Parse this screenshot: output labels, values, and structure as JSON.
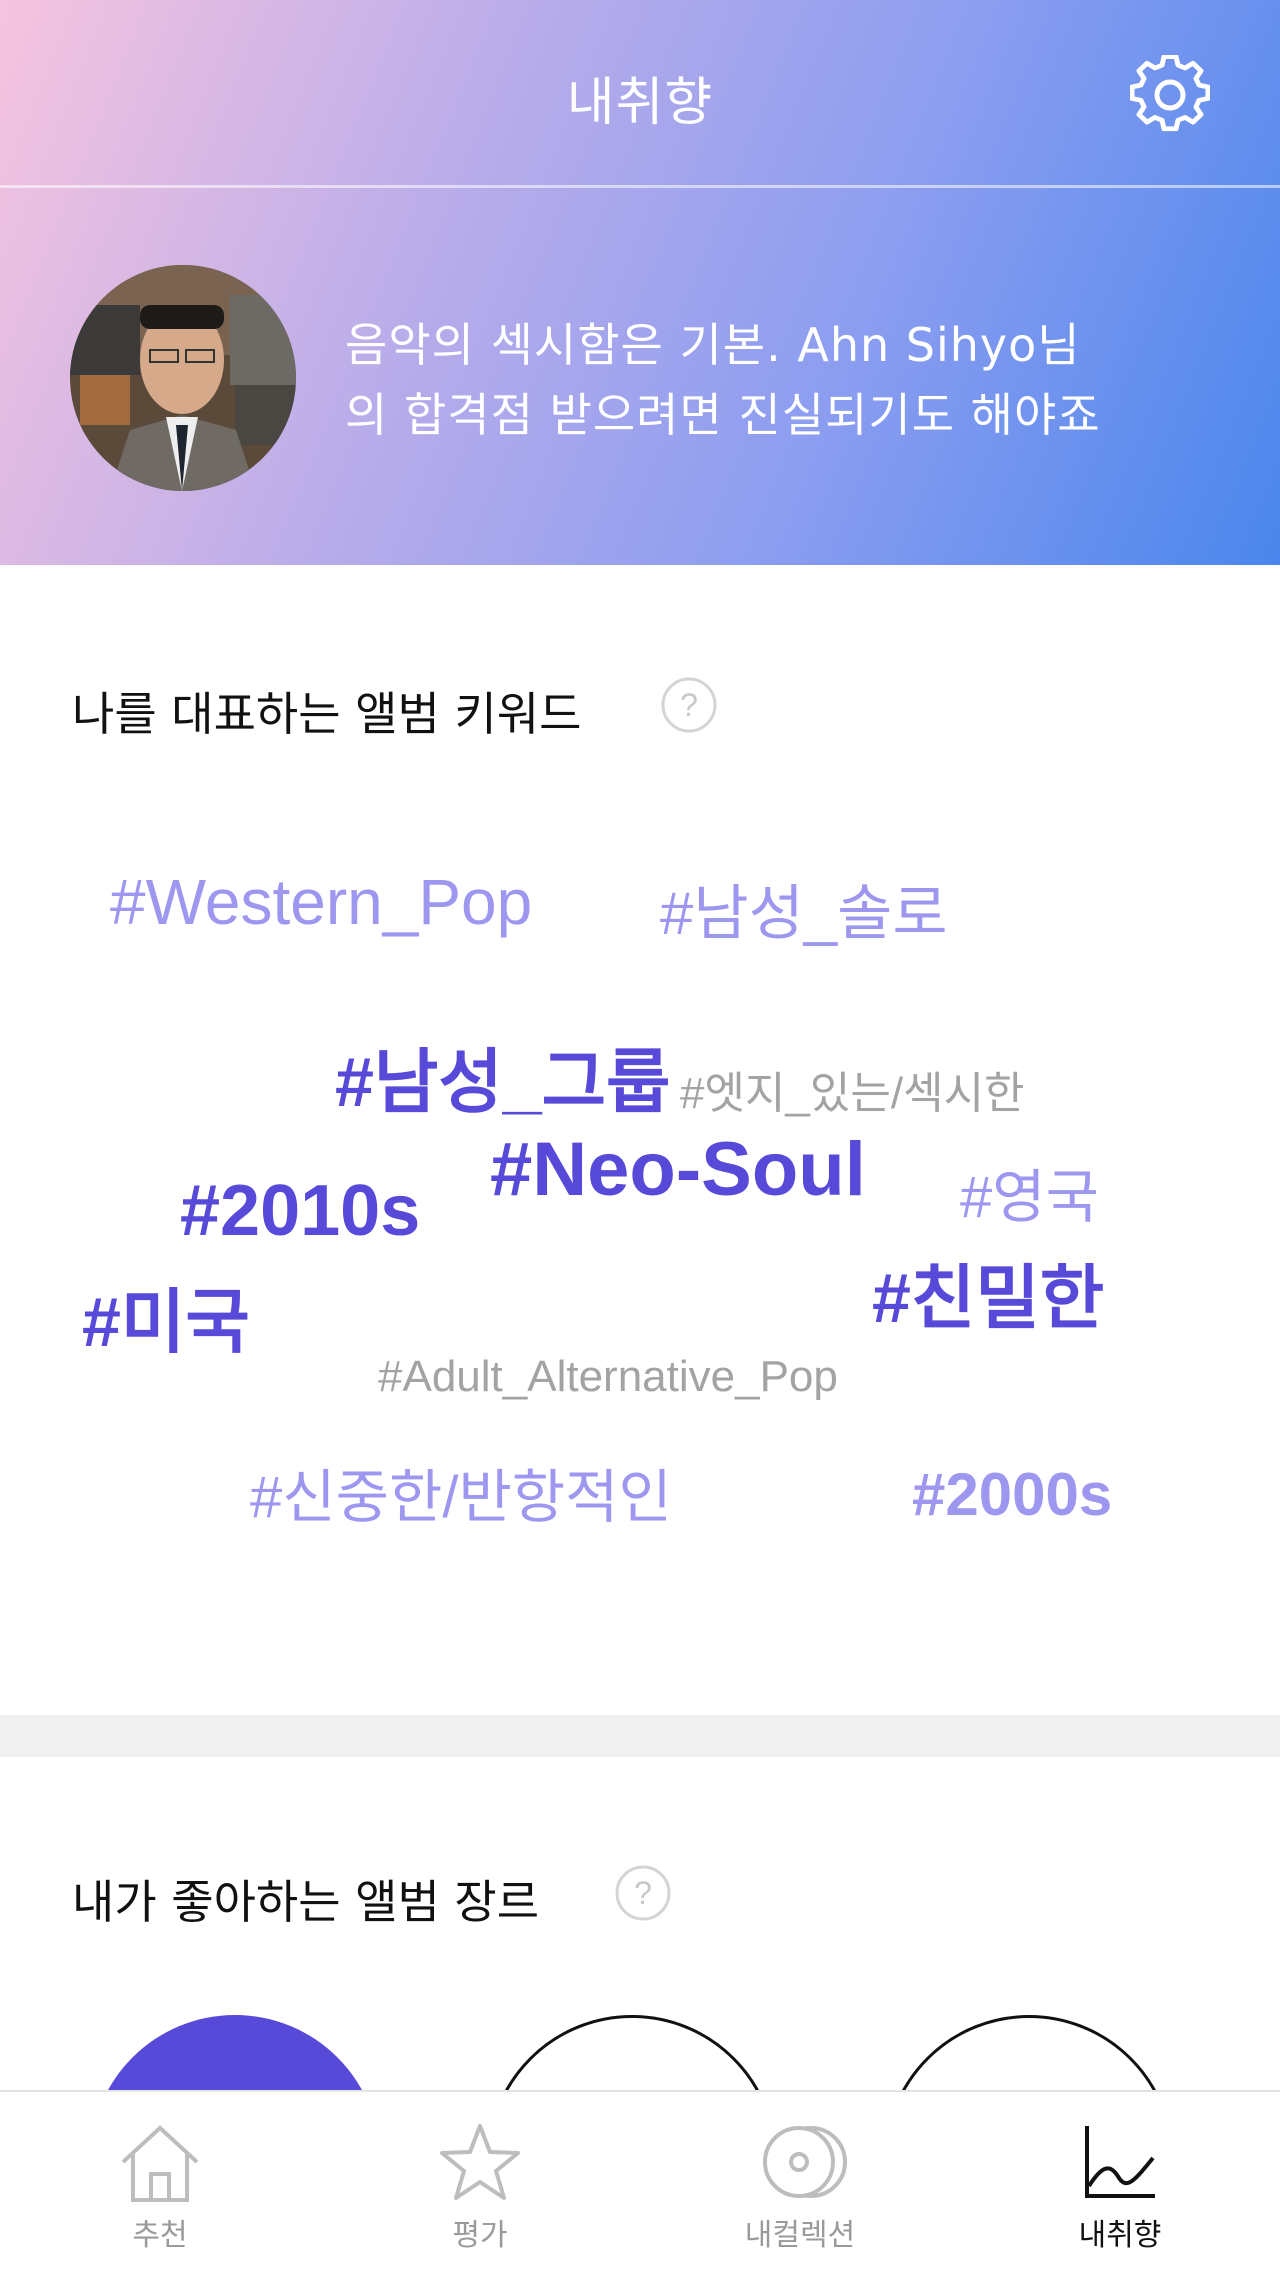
{
  "header": {
    "title": "내취향",
    "settings_icon": "gear-icon"
  },
  "profile": {
    "message_line1": "음악의 섹시함은 기본. Ahn Sihyo님",
    "message_line2": "의 합격점 받으려면 진실되기도 해야죠"
  },
  "keywords_section": {
    "title": "나를 대표하는 앨범 키워드",
    "help_icon": "question-circle-icon",
    "keywords": [
      {
        "text": "#Western_Pop",
        "color": "#9d97f0"
      },
      {
        "text": "#남성_솔로",
        "color": "#9d97f0"
      },
      {
        "text": "#남성_그룹",
        "color": "#574ad8"
      },
      {
        "text": "#엣지_있는/섹시한",
        "color": "#a3a3a3"
      },
      {
        "text": "#Neo-Soul",
        "color": "#574ad8"
      },
      {
        "text": "#영국",
        "color": "#9d97f0"
      },
      {
        "text": "#2010s",
        "color": "#574ad8"
      },
      {
        "text": "#친밀한",
        "color": "#574ad8"
      },
      {
        "text": "#미국",
        "color": "#574ad8"
      },
      {
        "text": "#Adult_Alternative_Pop",
        "color": "#a3a3a3"
      },
      {
        "text": "#신중한/반항적인",
        "color": "#9d97f0"
      },
      {
        "text": "#2000s",
        "color": "#9d97f0"
      }
    ]
  },
  "genres_section": {
    "title": "내가 좋아하는 앨범 장르",
    "help_icon": "question-circle-icon"
  },
  "tabbar": {
    "tabs": [
      {
        "label": "추천",
        "icon": "home-icon",
        "active": false
      },
      {
        "label": "평가",
        "icon": "star-icon",
        "active": false
      },
      {
        "label": "내컬렉션",
        "icon": "disc-icon",
        "active": false
      },
      {
        "label": "내취향",
        "icon": "chart-line-icon",
        "active": true
      }
    ]
  },
  "colors": {
    "accent_dark": "#574ad8",
    "accent_light": "#9d97f0",
    "muted": "#a3a3a3",
    "active_tab": "#111111",
    "inactive_tab": "#9a9a9a"
  }
}
